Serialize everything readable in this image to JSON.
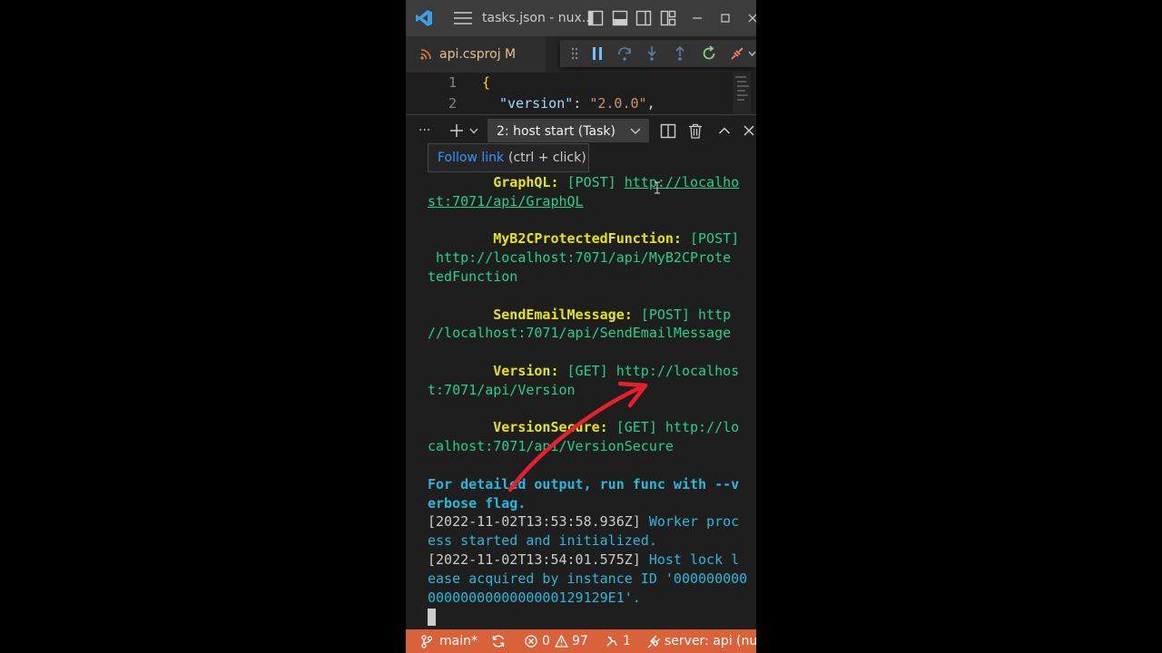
{
  "titlebar": {
    "title": "tasks.json - nux..."
  },
  "tab": {
    "name": "api.csproj",
    "modified_flag": "M"
  },
  "editor": {
    "line1_num": "1",
    "line2_num": "2",
    "line1_code": "{",
    "line2_key": "\"version\"",
    "line2_colon": ": ",
    "line2_value": "\"2.0.0\"",
    "line2_comma": ","
  },
  "panel": {
    "more_label": "···",
    "terminal_select": "2: host start (Task)"
  },
  "tooltip": {
    "link_text": "Follow link",
    "hint": "(ctrl + click)"
  },
  "terminal": {
    "graphql_name": "GraphQL:",
    "graphql_method": "[POST]",
    "graphql_url_a": "http://localho",
    "graphql_url_b": "st:7071/api/GraphQL",
    "myb2c_name": "MyB2CProtectedFunction:",
    "myb2c_method": "[POST]",
    "myb2c_url_a": "http://localhost:7071/api/MyB2CProte",
    "myb2c_url_b": "tedFunction",
    "send_name": "SendEmailMessage:",
    "send_method": "[POST]",
    "send_url_a": "http",
    "send_url_b": "//localhost:7071/api/SendEmailMessage",
    "version_name": "Version:",
    "version_method": "[GET]",
    "version_url_a": "http://localhos",
    "version_url_b": "t:7071/api/Version",
    "vsecure_name": "VersionSecure:",
    "vsecure_method": "[GET]",
    "vsecure_url_a": "http://lo",
    "vsecure_url_b": "calhost:7071/api/VersionSecure",
    "detail_a": "For detailed output, run func with --v",
    "detail_b": "erbose flag.",
    "log1_ts": "[2022-11-02T13:53:58.936Z]",
    "log1_a": "Worker proc",
    "log1_b": "ess started and initialized.",
    "log2_ts": "[2022-11-02T13:54:01.575Z]",
    "log2_a": "Host lock l",
    "log2_b": "ease acquired by instance ID '000000000",
    "log2_c": "0000000000000000129129E1'."
  },
  "statusbar": {
    "branch": "main*",
    "errors": "0",
    "warnings": "97",
    "ports": "1",
    "server": "server: api (nuxt"
  },
  "colors": {
    "statusbar_bg": "#d9623a",
    "annotation_arrow": "#e8202a",
    "terminal_yellow": "#e5e510",
    "terminal_green": "#23d18b",
    "terminal_cyan": "#29b8db"
  }
}
